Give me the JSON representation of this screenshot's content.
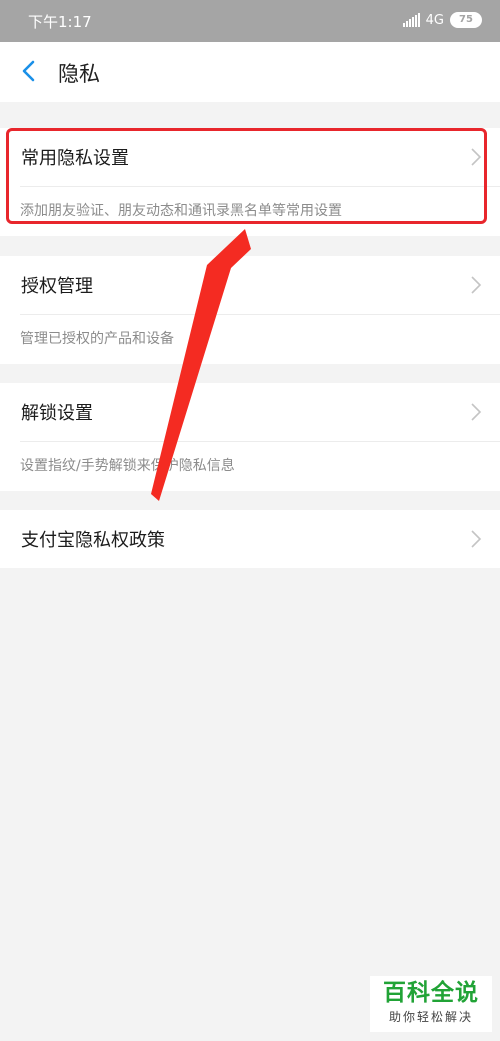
{
  "status_bar": {
    "time": "下午1:17",
    "network": "4G",
    "battery": "75"
  },
  "nav": {
    "back_icon": "chevron-left-icon",
    "title": "隐私",
    "accent_color": "#1a90e8"
  },
  "settings": [
    {
      "title": "常用隐私设置",
      "description": "添加朋友验证、朋友动态和通讯录黑名单等常用设置",
      "highlighted": true
    },
    {
      "title": "授权管理",
      "description": "管理已授权的产品和设备"
    },
    {
      "title": "解锁设置",
      "description": "设置指纹/手势解锁来保护隐私信息"
    },
    {
      "title": "支付宝隐私权政策"
    }
  ],
  "annotation": {
    "box_color": "#e8262c",
    "arrow_color": "#f42b22"
  },
  "watermark": {
    "logo": "百科全说",
    "slogan": "助你轻松解决",
    "color": "#21a336"
  }
}
